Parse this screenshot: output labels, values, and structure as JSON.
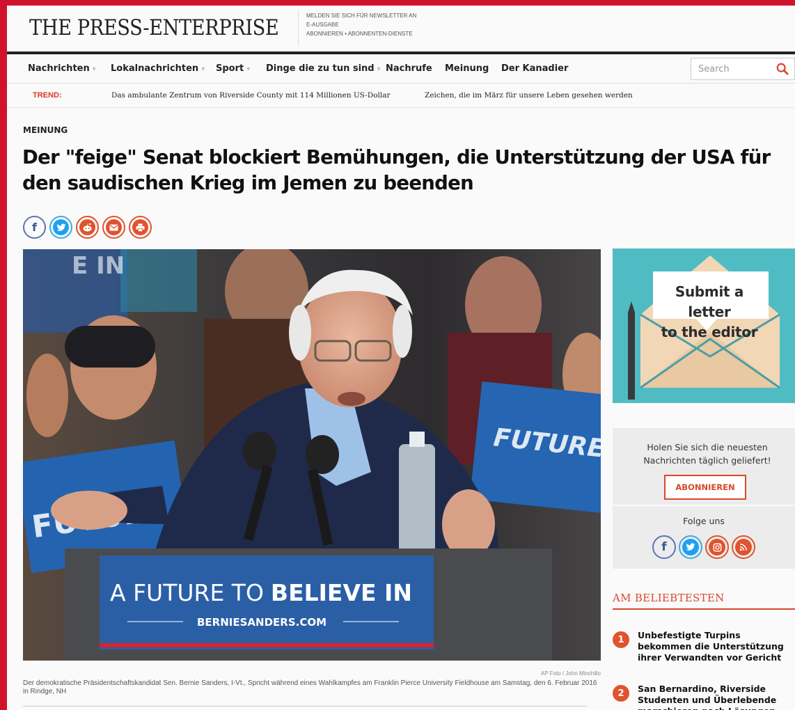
{
  "masthead": {
    "logo": "THE PRESS-ENTERPRISE",
    "links": [
      "MELDEN SIE SICH FÜR NEWSLETTER AN",
      "E-AUSGABE",
      "ABONNIEREN • ABONNENTEN-DIENSTE"
    ]
  },
  "nav": {
    "items": [
      {
        "label": "Nachrichten",
        "dropdown": true
      },
      {
        "label": "Lokalnachrichten",
        "dropdown": true
      },
      {
        "label": "Sport",
        "dropdown": true
      },
      {
        "label": "Dinge die zu tun sind",
        "dropdown": true
      },
      {
        "label": "Nachrufe",
        "dropdown": false
      },
      {
        "label": "Meinung",
        "dropdown": false
      },
      {
        "label": "Der Kanadier",
        "dropdown": false
      }
    ],
    "search_placeholder": "Search"
  },
  "trend": {
    "label": "TREND:",
    "links": [
      "Das ambulante Zentrum von Riverside County mit 114 Millionen US-Dollar",
      "Zeichen, die im März für unsere Leben gesehen werden"
    ]
  },
  "article": {
    "section": "MEINUNG",
    "headline": "Der \"feige\" Senat blockiert Bemühungen, die Unterstützung der USA für den saudischen Krieg im Jemen zu beenden",
    "share_icons": [
      "facebook-icon",
      "twitter-icon",
      "reddit-icon",
      "email-icon",
      "print-icon"
    ],
    "photo": {
      "podium_line1": "A FUTURE TO",
      "podium_line1_bold": "BELIEVE IN",
      "podium_line2": "BERNIESANDERS.COM",
      "sign_left": "FUTURE TO BELIEVE",
      "sign_right": "FUTURE BELIEVE",
      "sign_top": "E IN"
    },
    "credit": "AP Foto / John Minchillo",
    "caption": "Der demokratische Präsidentschaftskandidat Sen. Bernie Sanders, I-Vt., Spricht während eines Wahlkampfes am Franklin Pierce University Fieldhouse am Samstag, den 6. Februar 2016 in Rindge, NH"
  },
  "sidebar": {
    "letter_ad": {
      "line1": "Submit a letter",
      "line2": "to the editor"
    },
    "newsletter": {
      "text": "Holen Sie sich die neuesten Nachrichten täglich geliefert!",
      "button": "ABONNIEREN"
    },
    "follow": {
      "title": "Folge uns",
      "icons": [
        "facebook-icon",
        "twitter-icon",
        "instagram-icon",
        "rss-icon"
      ]
    },
    "popular": {
      "title": "AM BELIEBTESTEN",
      "items": [
        {
          "num": "1",
          "text": "Unbefestigte Turpins bekommen die Unterstützung ihrer Verwandten vor Gericht"
        },
        {
          "num": "2",
          "text": "San Bernardino, Riverside Studenten und Überlebende marschieren nach Lösungen"
        }
      ]
    }
  },
  "colors": {
    "frame": "#d0132d",
    "accent": "#d9472b",
    "teal": "#4fbcc4"
  }
}
